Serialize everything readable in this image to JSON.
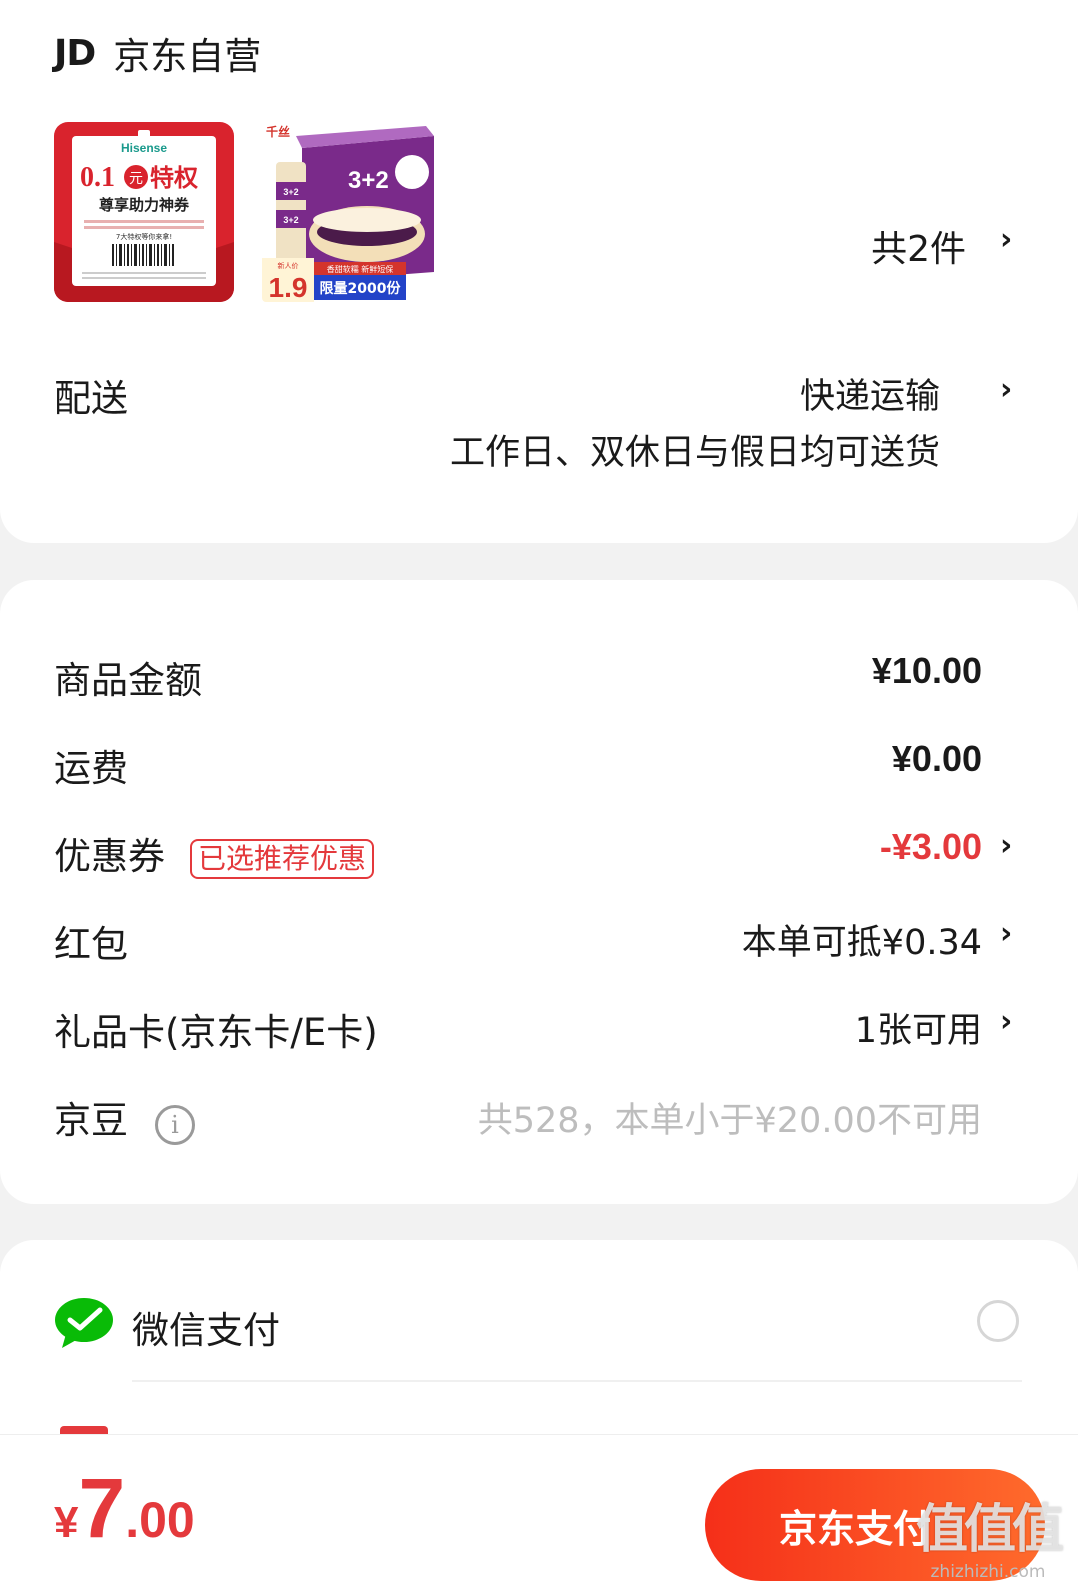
{
  "store": {
    "logo": "JD",
    "name": "京东自营",
    "thumb1": {
      "brand": "Hisense",
      "headline_num": "0.1",
      "headline_unit": "元",
      "headline_text": "特权",
      "subtitle": "尊享助力神券",
      "tagline": "7大特权等你来拿!"
    },
    "thumb2": {
      "brand": "千丝",
      "box_text": "3+2",
      "badge_new": "新人价",
      "price": "1.9",
      "ribbon": "香甜软糯 新鲜短保",
      "limit": "限量2000份"
    },
    "item_count": "共2件"
  },
  "delivery": {
    "label": "配送",
    "method": "快递运输",
    "note": "工作日、双休日与假日均可送货"
  },
  "summary": {
    "goods_amount": {
      "label": "商品金额",
      "value": "¥10.00"
    },
    "shipping": {
      "label": "运费",
      "value": "¥0.00"
    },
    "coupon": {
      "label": "优惠券",
      "tag": "已选推荐优惠",
      "value": "-¥3.00"
    },
    "red_packet": {
      "label": "红包",
      "value": "本单可抵¥0.34"
    },
    "gift_card": {
      "label": "礼品卡(京东卡/E卡)",
      "value": "1张可用"
    },
    "jingdou": {
      "label": "京豆",
      "value": "共528，本单小于¥20.00不可用"
    }
  },
  "payment": {
    "wechat_label": "微信支付"
  },
  "footer": {
    "currency": "¥",
    "total_int": "7",
    "total_dec": ".00",
    "pay_button": "京东支付",
    "watermark": "值值值",
    "watermark_url": "zhizhizhi.com"
  },
  "colors": {
    "accent": "#e4393c",
    "button_start": "#f52f19",
    "button_end": "#ff6b2c",
    "background": "#f2f2f2"
  }
}
